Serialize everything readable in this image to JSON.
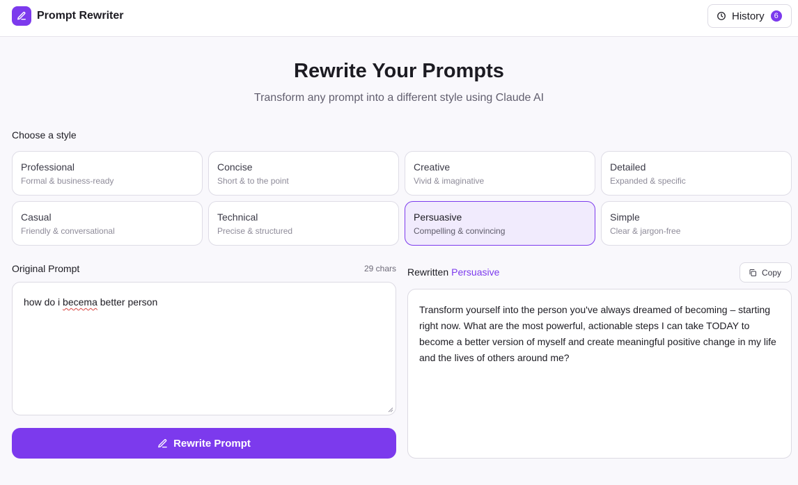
{
  "header": {
    "app_title": "Prompt Rewriter",
    "logo_icon": "pencil-icon",
    "history": {
      "label": "History",
      "count": "6",
      "icon": "clock-icon"
    }
  },
  "hero": {
    "title": "Rewrite Your Prompts",
    "subtitle": "Transform any prompt into a different style using Claude AI"
  },
  "styles": {
    "label": "Choose a style",
    "selected": "Persuasive",
    "items": [
      {
        "name": "Professional",
        "desc": "Formal & business-ready"
      },
      {
        "name": "Concise",
        "desc": "Short & to the point"
      },
      {
        "name": "Creative",
        "desc": "Vivid & imaginative"
      },
      {
        "name": "Detailed",
        "desc": "Expanded & specific"
      },
      {
        "name": "Casual",
        "desc": "Friendly & conversational"
      },
      {
        "name": "Technical",
        "desc": "Precise & structured"
      },
      {
        "name": "Persuasive",
        "desc": "Compelling & convincing"
      },
      {
        "name": "Simple",
        "desc": "Clear & jargon-free"
      }
    ]
  },
  "original": {
    "label": "Original Prompt",
    "char_count": "29 chars",
    "text_before": "how do i ",
    "text_typo": "becema",
    "text_after": " better person"
  },
  "rewrite_button": {
    "label": "Rewrite Prompt",
    "icon": "pencil-icon"
  },
  "rewritten": {
    "label": "Rewritten",
    "style": "Persuasive",
    "copy_label": "Copy",
    "copy_icon": "copy-icon",
    "text": "Transform yourself into the person you've always dreamed of becoming – starting right now. What are the most powerful, actionable steps I can take TODAY to become a better version of myself and create meaningful positive change in my life and the lives of others around me?"
  },
  "colors": {
    "accent": "#7c3aed",
    "selected_bg": "#f1ebfd",
    "page_bg": "#f9f8fc"
  }
}
